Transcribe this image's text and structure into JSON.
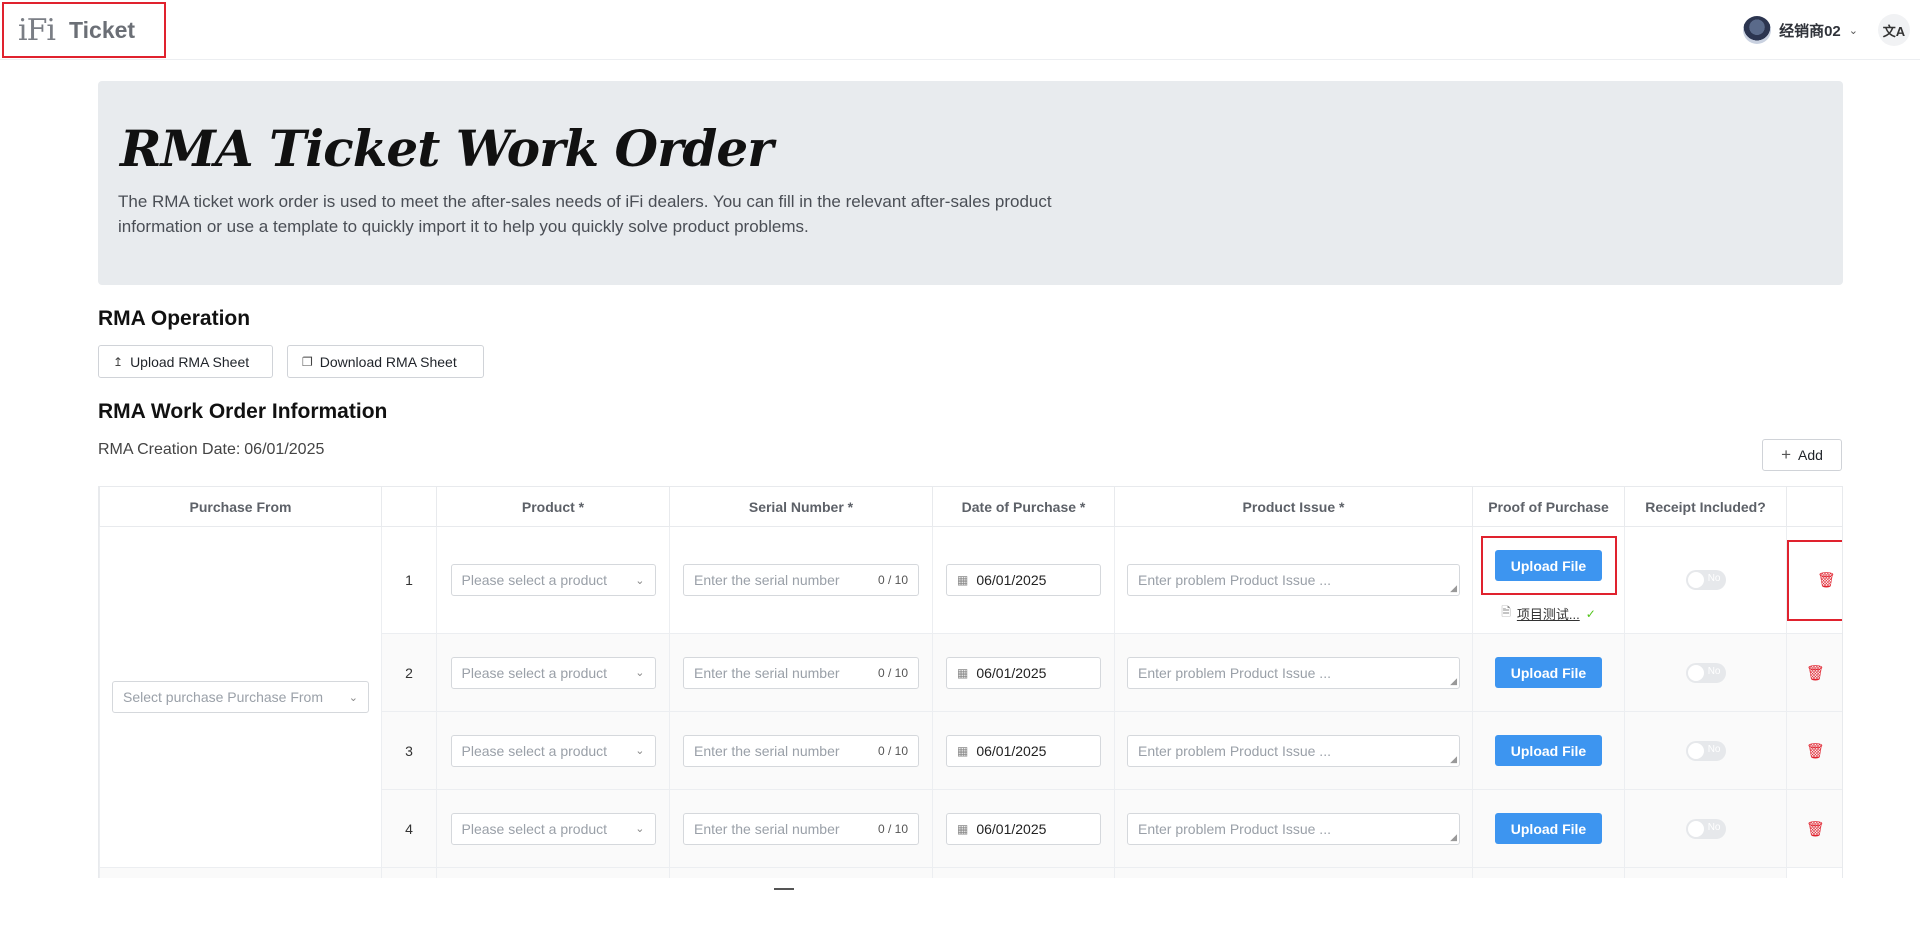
{
  "header": {
    "logo_text": "iFi",
    "app_title": "Ticket",
    "username": "经销商02",
    "language_icon": "translate-icon"
  },
  "hero": {
    "title": "RMA Ticket Work Order",
    "description": "The RMA ticket work order is used to meet the after-sales needs of iFi dealers. You can fill in the relevant after-sales product information or use a template to quickly import it to help you quickly solve product problems."
  },
  "operation": {
    "heading": "RMA Operation",
    "upload_label": "Upload RMA Sheet",
    "download_label": "Download RMA Sheet"
  },
  "work_order": {
    "heading": "RMA Work Order Information",
    "creation_label": "RMA Creation Date:",
    "creation_date": "06/01/2025",
    "add_label": "Add"
  },
  "table": {
    "columns": [
      "Purchase From",
      "",
      "Product *",
      "Serial Number *",
      "Date of Purchase *",
      "Product Issue *",
      "Proof of Purchase",
      "Receipt Included?",
      ""
    ],
    "purchase_from_placeholder": "Select purchase Purchase From",
    "rows": [
      {
        "index": "1",
        "product_placeholder": "Please select a product",
        "serial_placeholder": "Enter the serial number",
        "serial_count": "0 / 10",
        "date": "06/01/2025",
        "issue_placeholder": "Enter problem Product Issue ...",
        "upload_label": "Upload File",
        "file_name": "项目测试...",
        "receipt": "No"
      },
      {
        "index": "2",
        "product_placeholder": "Please select a product",
        "serial_placeholder": "Enter the serial number",
        "serial_count": "0 / 10",
        "date": "06/01/2025",
        "issue_placeholder": "Enter problem Product Issue ...",
        "upload_label": "Upload File",
        "receipt": "No"
      },
      {
        "index": "3",
        "product_placeholder": "Please select a product",
        "serial_placeholder": "Enter the serial number",
        "serial_count": "0 / 10",
        "date": "06/01/2025",
        "issue_placeholder": "Enter problem Product Issue ...",
        "upload_label": "Upload File",
        "receipt": "No"
      },
      {
        "index": "4",
        "product_placeholder": "Please select a product",
        "serial_placeholder": "Enter the serial number",
        "serial_count": "0 / 10",
        "date": "06/01/2025",
        "issue_placeholder": "Enter problem Product Issue ...",
        "upload_label": "Upload File",
        "receipt": "No"
      }
    ]
  },
  "colors": {
    "accent": "#3d95f0",
    "danger": "#e0222e",
    "hero_bg": "#e8ebee"
  }
}
